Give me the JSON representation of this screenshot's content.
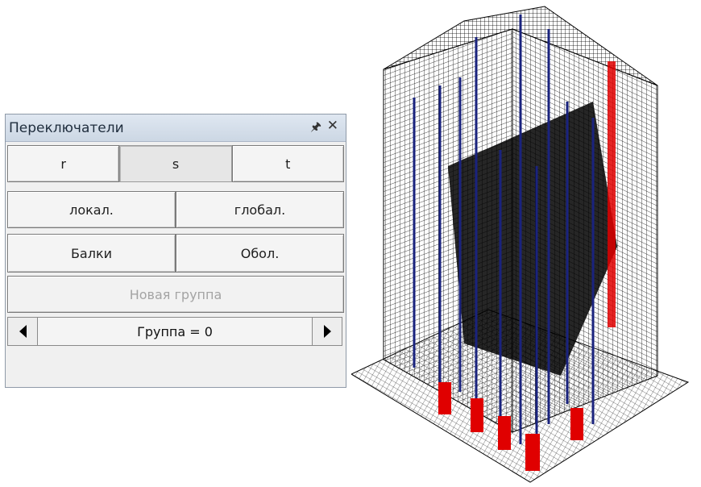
{
  "panel": {
    "title": "Переключатели",
    "pin_icon": "pin-icon",
    "close_icon": "close-icon",
    "axis_buttons": [
      "r",
      "s",
      "t"
    ],
    "axis_pressed": "s",
    "coord_buttons": [
      "локал.",
      "глобал."
    ],
    "element_buttons": [
      "Балки",
      "Обол."
    ],
    "new_group_label": "Новая группа",
    "group_label": "Группа = 0"
  },
  "model_view": {
    "icon": "building-mesh-icon",
    "colors": {
      "mesh": "#000000",
      "columns": "#1a237e",
      "highlight": "#e00000"
    }
  }
}
